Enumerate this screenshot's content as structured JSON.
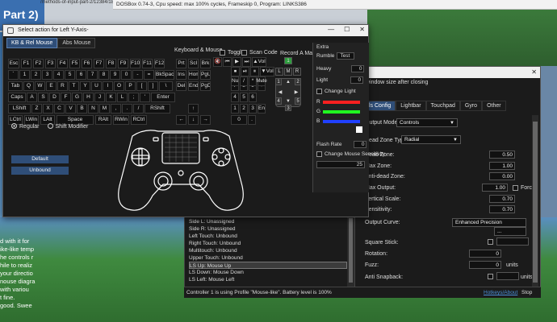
{
  "background": {
    "page_title": "Part 2)",
    "url_fragment": "/methods-of-input-part-2/12384/186#",
    "dosbox_bar": "DOSBox 0.74-3, Cpu speed: max 100% cycles, Frameskip 0, Program: LINKS386",
    "blog_lines": [
      "d with it for",
      "ike-like temp",
      "he controls r",
      "hile to realiz",
      "your directio",
      "nouse diagra",
      "with variou",
      "t fine.",
      "",
      "good. Swee"
    ]
  },
  "dialog": {
    "title": "Select action for Left Y-Axis-",
    "tabs": [
      {
        "label": "KB & Rel Mouse",
        "active": true
      },
      {
        "label": "Abs Mouse",
        "active": false
      }
    ],
    "keyboard_title": "Keyboard & Mouse",
    "toggle_label": "Toggle",
    "scan_code_label": "Scan Code",
    "record_label": "Record A Macro",
    "modes": [
      {
        "label": "Regular",
        "selected": true
      },
      {
        "label": "Shift Modifier",
        "selected": false
      }
    ],
    "default_button": "Default",
    "unbound_button": "Unbound",
    "keys": {
      "row1": [
        "Esc",
        "F1",
        "F2",
        "F3",
        "F4",
        "F5",
        "F6",
        "F7",
        "F8",
        "F9",
        "F10",
        "F11",
        "F12"
      ],
      "row1b": [
        "Prt",
        "Scl",
        "Brk"
      ],
      "row2": [
        "`",
        "1",
        "2",
        "3",
        "4",
        "5",
        "6",
        "7",
        "8",
        "9",
        "0",
        "-",
        "=",
        "BkSpace"
      ],
      "row2b": [
        "Ins",
        "Hom",
        "PgU"
      ],
      "row2c": [
        "Num",
        "/",
        "*",
        "-"
      ],
      "row3": [
        "Tab",
        "Q",
        "W",
        "E",
        "R",
        "T",
        "Y",
        "U",
        "I",
        "O",
        "P",
        "[",
        "]",
        "\\"
      ],
      "row3b": [
        "Del",
        "End",
        "PgD"
      ],
      "row3c": [
        "7",
        "8",
        "9",
        "+"
      ],
      "row4": [
        "Caps",
        "A",
        "S",
        "D",
        "F",
        "G",
        "H",
        "J",
        "K",
        "L",
        ";",
        "'",
        "Enter"
      ],
      "row4c": [
        "4",
        "5",
        "6"
      ],
      "row5": [
        "LShift",
        "Z",
        "X",
        "C",
        "V",
        "B",
        "N",
        "M",
        ",",
        ".",
        "/",
        "RShift"
      ],
      "row5b": [
        "↑"
      ],
      "row5c": [
        "1",
        "2",
        "3",
        "Enter"
      ],
      "row6": [
        "LCtrl",
        "LWin",
        "LAlt",
        "Space",
        "RAlt",
        "RWin",
        "RCtrl"
      ],
      "row6b": [
        "←",
        "↓",
        "→"
      ],
      "row6c": [
        "0",
        "."
      ],
      "media1": [
        "🔇",
        "⏮",
        "▶",
        "⏭",
        "▲Vol"
      ],
      "media2": [
        "⏹",
        "⏯",
        "⏸",
        "▼Vol"
      ]
    },
    "mouse": {
      "scroll_up_num": "1",
      "left": "L",
      "mid": "M",
      "right": "R",
      "mute_label": "Mute",
      "arrows": [
        "▲",
        "◀",
        "▶",
        "▼"
      ],
      "num_tl": "1",
      "num_tr": "2",
      "num_bl": "4",
      "num_br": "5",
      "num_b": "3"
    },
    "extra": {
      "title": "Extra",
      "rumble_label": "Rumble",
      "test_button": "Test",
      "heavy_label": "Heavy",
      "heavy_value": "0",
      "light_label": "Light",
      "light_value": "0",
      "change_light_label": "Change Light",
      "rgb_labels": [
        "R",
        "G",
        "B"
      ],
      "rgb_colors": [
        "#ff2020",
        "#20ff20",
        "#2040ff"
      ],
      "flash_rate_label": "Flash Rate",
      "flash_rate_value": "0",
      "change_mouse_label": "Change Mouse Sensitivity",
      "mouse_sens_value": "25"
    }
  },
  "config": {
    "subtitle": "window size after closing",
    "tabs": [
      {
        "label": "ls Config",
        "active": true
      },
      {
        "label": "Lightbar",
        "active": false
      },
      {
        "label": "Touchpad",
        "active": false
      },
      {
        "label": "Gyro",
        "active": false
      },
      {
        "label": "Other",
        "active": false
      }
    ],
    "output_mode_label": "Output Mode",
    "output_mode_value": "Controls",
    "dead_zone_type_label": "Dead Zone Type",
    "dead_zone_type_value": "Radial",
    "dead_zone_label": "Dead Zone:",
    "dead_zone_value": "0.50",
    "max_zone_label": "Max Zone:",
    "max_zone_value": "1.00",
    "anti_dead_label": "Anti-dead Zone:",
    "anti_dead_value": "0.00",
    "max_output_label": "Max Output:",
    "max_output_value": "1.00",
    "force_label": "Force",
    "vertical_scale_label": "Vertical Scale:",
    "vertical_scale_value": "0.70",
    "sensitivity_label": "Sensitivity:",
    "sensitivity_value": "0.70",
    "output_curve_label": "Output Curve:",
    "output_curve_value": "Enhanced Precision",
    "square_stick_label": "Square Stick:",
    "rotation_label": "Rotation:",
    "rotation_value": "0",
    "fuzz_label": "Fuzz:",
    "fuzz_value": "0",
    "anti_snapback_label": "Anti Snapback:",
    "units_label": "units",
    "more_label": "..."
  },
  "profile_list": {
    "items": [
      {
        "label": "Side L: Unassigned",
        "selected": false
      },
      {
        "label": "Side R: Unassigned",
        "selected": false
      },
      {
        "label": "Left Touch: Unbound",
        "selected": false
      },
      {
        "label": "Right Touch: Unbound",
        "selected": false
      },
      {
        "label": "Multitouch: Unbound",
        "selected": false
      },
      {
        "label": "Upper Touch: Unbound",
        "selected": false
      },
      {
        "label": "LS Up: Mouse Up",
        "selected": true
      },
      {
        "label": "LS Down: Mouse Down",
        "selected": false
      },
      {
        "label": "LS Left: Mouse Left",
        "selected": false
      }
    ]
  },
  "status": {
    "message": "Controller 1 is using Profile \"Mouse-like\". Battery level is 100%",
    "hotkeys_link": "Hotkeys/About",
    "stop_button": "Stop"
  }
}
